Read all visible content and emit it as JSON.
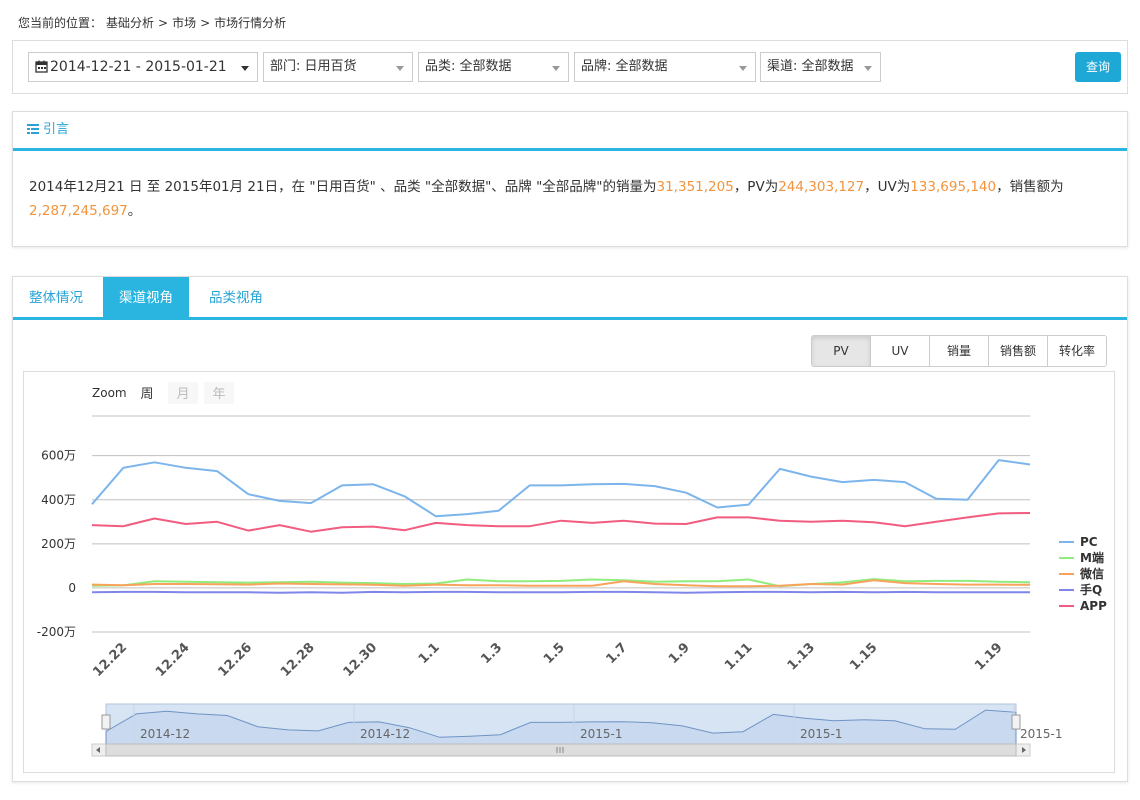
{
  "breadcrumb": {
    "prefix": "您当前的位置：",
    "items": [
      "基础分析",
      ">",
      "市场",
      ">",
      "市场行情分析"
    ]
  },
  "filters": {
    "date_range": "2014-12-21 - 2015-01-21",
    "department": "部门: 日用百货",
    "category": "品类: 全部数据",
    "brand": "品牌: 全部数据",
    "channel": "渠道: 全部数据",
    "query_label": "查询"
  },
  "intro": {
    "title": "引言",
    "text_1": "2014年12月21 日 至 2015年01月 21日，在 \"日用百货\" 、品类 \"全部数据\"、品牌 \"全部品牌\"的销量为",
    "sales_volume": "31,351,205",
    "text_2": "，PV为",
    "pv": "244,303,127",
    "text_3": "，UV为",
    "uv": "133,695,140",
    "text_4": "，销售额为",
    "sales_amount": "2,287,245,697",
    "text_5": "。"
  },
  "tabs": [
    "整体情况",
    "渠道视角",
    "品类视角"
  ],
  "metric_buttons": [
    "PV",
    "UV",
    "销量",
    "销售额",
    "转化率"
  ],
  "colors": {
    "accent": "#29b5e0",
    "highlight": "#f2943d"
  },
  "chart_data": {
    "type": "line",
    "zoom": {
      "label": "Zoom",
      "options": [
        "周",
        "月",
        "年"
      ],
      "selected": "周"
    },
    "x": [
      "12.21",
      "12.22",
      "12.23",
      "12.24",
      "12.25",
      "12.26",
      "12.27",
      "12.28",
      "12.29",
      "12.30",
      "12.31",
      "1.1",
      "1.2",
      "1.3",
      "1.4",
      "1.5",
      "1.6",
      "1.7",
      "1.8",
      "1.9",
      "1.10",
      "1.11",
      "1.12",
      "1.13",
      "1.14",
      "1.15",
      "1.16",
      "1.17",
      "1.18",
      "1.19",
      "1.20"
    ],
    "x_tick_labels": [
      "12.22",
      "12.24",
      "12.26",
      "12.28",
      "12.30",
      "1.1",
      "1.3",
      "1.5",
      "1.7",
      "1.9",
      "1.11",
      "1.13",
      "1.15",
      "1.19"
    ],
    "y_ticks": [
      -200,
      0,
      200,
      400,
      600
    ],
    "y_tick_labels": [
      "-200万",
      "0",
      "200万",
      "400万",
      "600万"
    ],
    "ylim": [
      -200,
      780
    ],
    "unit": "万",
    "series": [
      {
        "name": "PC",
        "color": "#7cb5ec",
        "values": [
          380,
          545,
          570,
          545,
          530,
          425,
          395,
          385,
          465,
          470,
          415,
          325,
          335,
          350,
          465,
          465,
          470,
          472,
          462,
          432,
          365,
          378,
          540,
          505,
          480,
          490,
          480,
          405,
          400,
          580,
          560
        ]
      },
      {
        "name": "M端",
        "color": "#90ed7d",
        "values": [
          10,
          12,
          30,
          28,
          26,
          24,
          26,
          28,
          24,
          22,
          18,
          20,
          38,
          30,
          30,
          32,
          38,
          35,
          28,
          30,
          30,
          38,
          8,
          18,
          25,
          40,
          30,
          32,
          32,
          28,
          26
        ]
      },
      {
        "name": "微信",
        "color": "#f7a35c",
        "values": [
          15,
          12,
          18,
          18,
          17,
          15,
          20,
          18,
          16,
          14,
          10,
          15,
          12,
          12,
          10,
          10,
          10,
          30,
          18,
          12,
          8,
          8,
          10,
          18,
          15,
          35,
          22,
          18,
          15,
          15,
          14
        ]
      },
      {
        "name": "手Q",
        "color": "#8085e9",
        "values": [
          -20,
          -18,
          -18,
          -20,
          -20,
          -20,
          -22,
          -20,
          -22,
          -18,
          -20,
          -18,
          -18,
          -20,
          -20,
          -20,
          -18,
          -18,
          -20,
          -22,
          -20,
          -18,
          -18,
          -20,
          -18,
          -20,
          -18,
          -20,
          -20,
          -20,
          -20
        ]
      },
      {
        "name": "APP",
        "color": "#f15c80",
        "values": [
          285,
          280,
          315,
          290,
          300,
          260,
          285,
          255,
          275,
          278,
          262,
          295,
          285,
          280,
          280,
          305,
          295,
          305,
          292,
          290,
          320,
          320,
          305,
          300,
          305,
          298,
          280,
          300,
          320,
          338,
          340
        ]
      }
    ],
    "navigator_labels": [
      "2014-12",
      "2014-12",
      "2015-1",
      "2015-1",
      "2015-1"
    ]
  }
}
